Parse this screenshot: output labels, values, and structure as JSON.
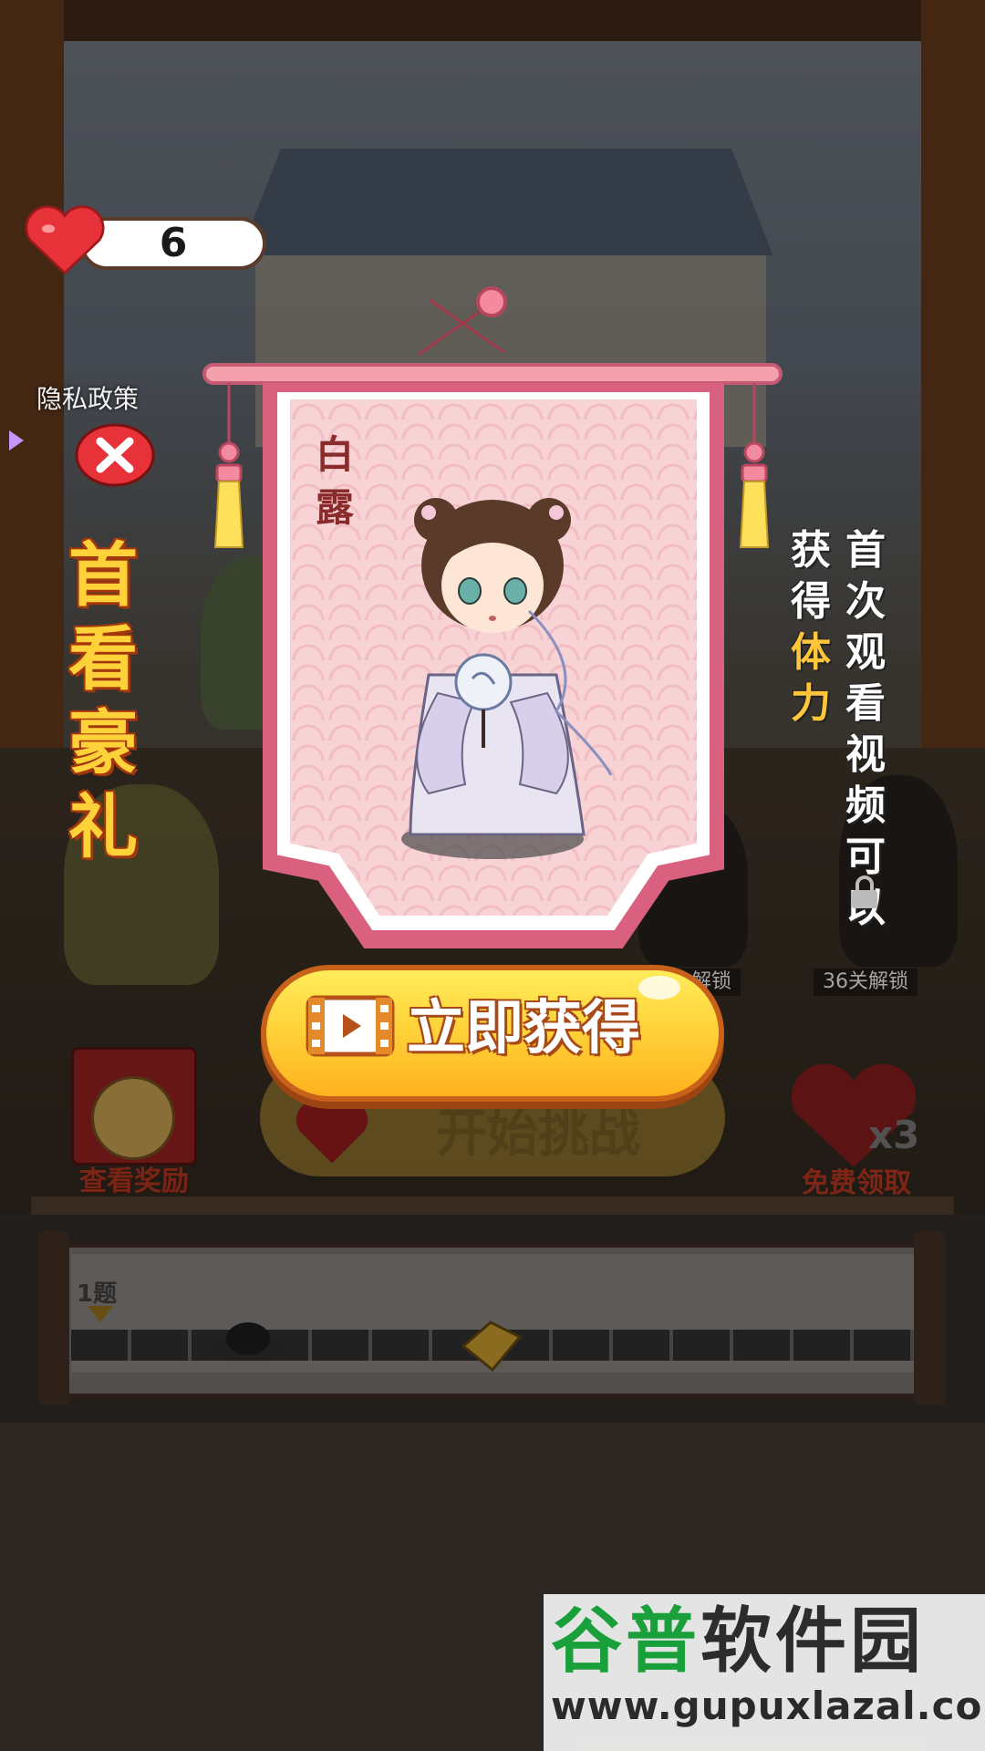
{
  "status": {
    "hearts": "6"
  },
  "left_panel": {
    "privacy_label": "隐私政策",
    "promo_chars": [
      "首",
      "看",
      "豪",
      "礼"
    ]
  },
  "scroll": {
    "name_chars": [
      "白",
      "露"
    ]
  },
  "right_text": {
    "col1": [
      {
        "t": "获",
        "hl": false
      },
      {
        "t": "得",
        "hl": false
      },
      {
        "t": "体",
        "hl": true
      },
      {
        "t": "力",
        "hl": true
      }
    ],
    "col2": [
      "首",
      "次",
      "观",
      "看",
      "视",
      "频",
      "可",
      "以"
    ]
  },
  "unlock_tags": [
    "解锁",
    "36关解锁"
  ],
  "cta": {
    "label": "立即获得"
  },
  "background_buttons": {
    "start_label": "开始挑战",
    "rewards_label": "查看奖励",
    "free_label": "免费领取",
    "free_multiplier": "x3"
  },
  "progress": {
    "level_label": "1题"
  },
  "watermark": {
    "title_green": "谷普",
    "title_dark": "软件园",
    "url": "www.gupuxlazal.com"
  },
  "colors": {
    "heart": "#e8323a",
    "cta_yellow": "#ffd33a",
    "scroll_pink": "#d9607e",
    "promo_gold": "#ffd23a",
    "highlight": "#ffc63a"
  },
  "icons": [
    "heart-icon",
    "close-icon",
    "video-icon",
    "lock-icon",
    "arrow-icon"
  ]
}
